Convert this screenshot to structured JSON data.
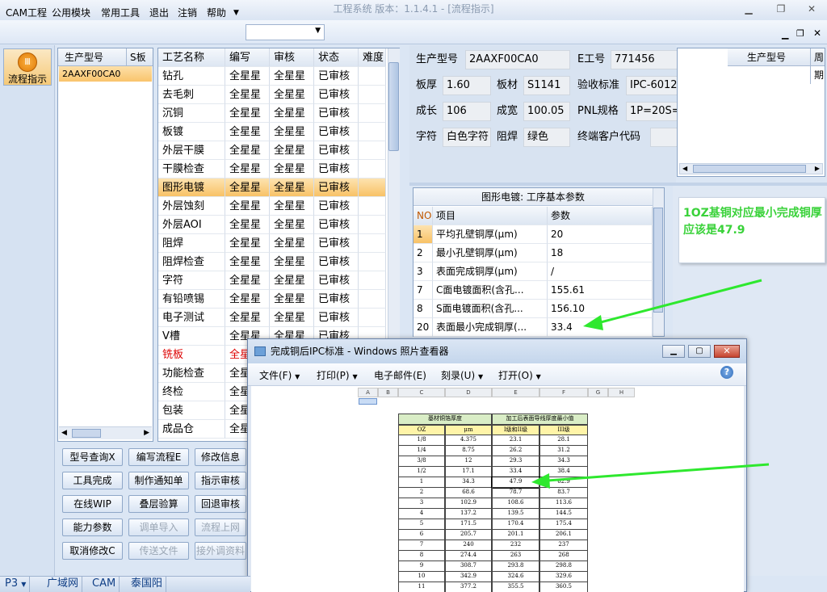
{
  "window": {
    "title": "工程系统  版本：1.1.4.1 - [流程指示]"
  },
  "menu": [
    "CAM工程",
    "公用模块",
    "常用工具",
    "退出",
    "注销",
    "帮助"
  ],
  "left": {
    "flow_button": "流程指示"
  },
  "model_list": {
    "headers": [
      "生产型号",
      "S板"
    ],
    "rows": [
      [
        "2AAXF00CA0",
        ""
      ]
    ]
  },
  "process": {
    "headers": [
      "工艺名称",
      "编写",
      "审核",
      "状态",
      "难度"
    ],
    "rows": [
      [
        "钻孔",
        "全星星",
        "全星星",
        "已审核"
      ],
      [
        "去毛刺",
        "全星星",
        "全星星",
        "已审核"
      ],
      [
        "沉铜",
        "全星星",
        "全星星",
        "已审核"
      ],
      [
        "板镀",
        "全星星",
        "全星星",
        "已审核"
      ],
      [
        "外层干膜",
        "全星星",
        "全星星",
        "已审核"
      ],
      [
        "干膜检查",
        "全星星",
        "全星星",
        "已审核"
      ],
      [
        "图形电镀",
        "全星星",
        "全星星",
        "已审核"
      ],
      [
        "外层蚀刻",
        "全星星",
        "全星星",
        "已审核"
      ],
      [
        "外层AOI",
        "全星星",
        "全星星",
        "已审核"
      ],
      [
        "阻焊",
        "全星星",
        "全星星",
        "已审核"
      ],
      [
        "阻焊检查",
        "全星星",
        "全星星",
        "已审核"
      ],
      [
        "字符",
        "全星星",
        "全星星",
        "已审核"
      ],
      [
        "有铅喷锡",
        "全星星",
        "全星星",
        "已审核"
      ],
      [
        "电子测试",
        "全星星",
        "全星星",
        "已审核"
      ],
      [
        "V槽",
        "全星星",
        "全星星",
        "已审核"
      ],
      [
        "铣板",
        "全星",
        "",
        ""
      ],
      [
        "功能检查",
        "全星",
        "",
        ""
      ],
      [
        "终检",
        "全星",
        "",
        ""
      ],
      [
        "包装",
        "全星",
        "",
        ""
      ],
      [
        "成品仓",
        "全星",
        "",
        ""
      ]
    ]
  },
  "buttons": [
    [
      "型号查询X",
      "编写流程E",
      "修改信息"
    ],
    [
      "工具完成",
      "制作通知单",
      "指示审核"
    ],
    [
      "在线WIP",
      "叠层验算",
      "回退审核"
    ],
    [
      "能力参数",
      "调单导入",
      "流程上网"
    ],
    [
      "取消修改C",
      "传送文件",
      "接外调资料"
    ]
  ],
  "info": {
    "prod_label": "生产型号",
    "prod": "2AAXF00CA0",
    "e_label": "E工号",
    "e": "771456",
    "thick_label": "板厚",
    "thick": "1.60",
    "mat_label": "板材",
    "mat": "S1141",
    "std_label": "验收标准",
    "std": "IPC-6012",
    "len_label": "成长",
    "len": "106",
    "wid_label": "成宽",
    "wid": "100.05",
    "pnl_label": "PNL规格",
    "pnl": "1P=20S=",
    "char_label": "字符",
    "char": "白色字符",
    "mask_label": "阻焊",
    "mask": "绿色",
    "cust_label": "终端客户代码",
    "cust": ""
  },
  "right_grid": {
    "headers": [
      "生产型号",
      "周期"
    ]
  },
  "params": {
    "title": "图形电镀: 工序基本参数",
    "headers": [
      "NO",
      "项目",
      "参数"
    ],
    "rows": [
      [
        "1",
        "平均孔壁铜厚(μm)",
        "20"
      ],
      [
        "2",
        "最小孔壁铜厚(μm)",
        "18"
      ],
      [
        "3",
        "表面完成铜厚(μm)",
        "/"
      ],
      [
        "7",
        "C面电镀面积(含孔...",
        "155.61"
      ],
      [
        "8",
        "S面电镀面积(含孔...",
        "156.10"
      ],
      [
        "20",
        "表面最小完成铜厚(...",
        "33.4"
      ]
    ]
  },
  "annotation": "1OZ基铜对应最小完成铜厚应该是47.9",
  "viewer": {
    "title": "完成铜后IPC标准 - Windows 照片查看器",
    "menu": [
      "文件(F)",
      "打印(P)",
      "电子邮件(E)",
      "刻录(U)",
      "打开(O)"
    ]
  },
  "sheet": {
    "cols": [
      "A",
      "B",
      "C",
      "D",
      "E",
      "F",
      "G",
      "H"
    ],
    "head1": [
      "基材铜箔厚度",
      "加工后表面导线厚度最小值"
    ],
    "head2": [
      "OZ",
      "μm",
      "I级和II级",
      "III级"
    ],
    "rows": [
      [
        "1/8",
        "4.375",
        "23.1",
        "28.1"
      ],
      [
        "1/4",
        "8.75",
        "26.2",
        "31.2"
      ],
      [
        "3/8",
        "12",
        "29.3",
        "34.3"
      ],
      [
        "1/2",
        "17.1",
        "33.4",
        "38.4"
      ],
      [
        "1",
        "34.3",
        "47.9",
        "62.9"
      ],
      [
        "2",
        "68.6",
        "78.7",
        "83.7"
      ],
      [
        "3",
        "102.9",
        "108.6",
        "113.6"
      ],
      [
        "4",
        "137.2",
        "139.5",
        "144.5"
      ],
      [
        "5",
        "171.5",
        "170.4",
        "175.4"
      ],
      [
        "6",
        "205.7",
        "201.1",
        "206.1"
      ],
      [
        "7",
        "240",
        "232",
        "237"
      ],
      [
        "8",
        "274.4",
        "263",
        "268"
      ],
      [
        "9",
        "308.7",
        "293.8",
        "298.8"
      ],
      [
        "10",
        "342.9",
        "324.6",
        "329.6"
      ],
      [
        "11",
        "377.2",
        "355.5",
        "360.5"
      ]
    ]
  },
  "status": [
    "P3",
    "广域网",
    "CAM",
    "泰国阳"
  ],
  "colors": {
    "accent_green": "#2ee82e",
    "selection": "#f9c46c",
    "red_text": "#dd0000"
  }
}
